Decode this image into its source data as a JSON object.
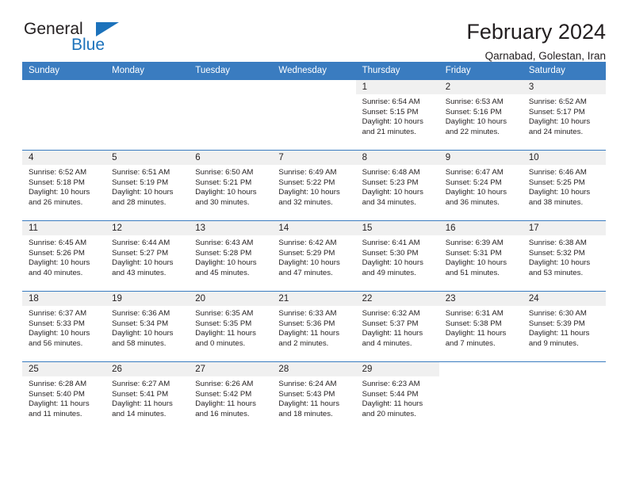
{
  "brand": {
    "name_part1": "General",
    "name_part2": "Blue",
    "triangle_icon": "triangle-icon",
    "accent_color": "#1c72bb"
  },
  "header": {
    "title": "February 2024",
    "subtitle": "Qarnabad, Golestan, Iran"
  },
  "theme": {
    "header_blue": "#3a7cc0",
    "daynum_band": "#f0f0f0",
    "text": "#231f20"
  },
  "weekday_headers": [
    "Sunday",
    "Monday",
    "Tuesday",
    "Wednesday",
    "Thursday",
    "Friday",
    "Saturday"
  ],
  "weeks": [
    [
      {
        "day": "",
        "sunrise": "",
        "sunset": "",
        "daylight_line1": "",
        "daylight_line2": ""
      },
      {
        "day": "",
        "sunrise": "",
        "sunset": "",
        "daylight_line1": "",
        "daylight_line2": ""
      },
      {
        "day": "",
        "sunrise": "",
        "sunset": "",
        "daylight_line1": "",
        "daylight_line2": ""
      },
      {
        "day": "",
        "sunrise": "",
        "sunset": "",
        "daylight_line1": "",
        "daylight_line2": ""
      },
      {
        "day": "1",
        "sunrise": "Sunrise: 6:54 AM",
        "sunset": "Sunset: 5:15 PM",
        "daylight_line1": "Daylight: 10 hours",
        "daylight_line2": "and 21 minutes."
      },
      {
        "day": "2",
        "sunrise": "Sunrise: 6:53 AM",
        "sunset": "Sunset: 5:16 PM",
        "daylight_line1": "Daylight: 10 hours",
        "daylight_line2": "and 22 minutes."
      },
      {
        "day": "3",
        "sunrise": "Sunrise: 6:52 AM",
        "sunset": "Sunset: 5:17 PM",
        "daylight_line1": "Daylight: 10 hours",
        "daylight_line2": "and 24 minutes."
      }
    ],
    [
      {
        "day": "4",
        "sunrise": "Sunrise: 6:52 AM",
        "sunset": "Sunset: 5:18 PM",
        "daylight_line1": "Daylight: 10 hours",
        "daylight_line2": "and 26 minutes."
      },
      {
        "day": "5",
        "sunrise": "Sunrise: 6:51 AM",
        "sunset": "Sunset: 5:19 PM",
        "daylight_line1": "Daylight: 10 hours",
        "daylight_line2": "and 28 minutes."
      },
      {
        "day": "6",
        "sunrise": "Sunrise: 6:50 AM",
        "sunset": "Sunset: 5:21 PM",
        "daylight_line1": "Daylight: 10 hours",
        "daylight_line2": "and 30 minutes."
      },
      {
        "day": "7",
        "sunrise": "Sunrise: 6:49 AM",
        "sunset": "Sunset: 5:22 PM",
        "daylight_line1": "Daylight: 10 hours",
        "daylight_line2": "and 32 minutes."
      },
      {
        "day": "8",
        "sunrise": "Sunrise: 6:48 AM",
        "sunset": "Sunset: 5:23 PM",
        "daylight_line1": "Daylight: 10 hours",
        "daylight_line2": "and 34 minutes."
      },
      {
        "day": "9",
        "sunrise": "Sunrise: 6:47 AM",
        "sunset": "Sunset: 5:24 PM",
        "daylight_line1": "Daylight: 10 hours",
        "daylight_line2": "and 36 minutes."
      },
      {
        "day": "10",
        "sunrise": "Sunrise: 6:46 AM",
        "sunset": "Sunset: 5:25 PM",
        "daylight_line1": "Daylight: 10 hours",
        "daylight_line2": "and 38 minutes."
      }
    ],
    [
      {
        "day": "11",
        "sunrise": "Sunrise: 6:45 AM",
        "sunset": "Sunset: 5:26 PM",
        "daylight_line1": "Daylight: 10 hours",
        "daylight_line2": "and 40 minutes."
      },
      {
        "day": "12",
        "sunrise": "Sunrise: 6:44 AM",
        "sunset": "Sunset: 5:27 PM",
        "daylight_line1": "Daylight: 10 hours",
        "daylight_line2": "and 43 minutes."
      },
      {
        "day": "13",
        "sunrise": "Sunrise: 6:43 AM",
        "sunset": "Sunset: 5:28 PM",
        "daylight_line1": "Daylight: 10 hours",
        "daylight_line2": "and 45 minutes."
      },
      {
        "day": "14",
        "sunrise": "Sunrise: 6:42 AM",
        "sunset": "Sunset: 5:29 PM",
        "daylight_line1": "Daylight: 10 hours",
        "daylight_line2": "and 47 minutes."
      },
      {
        "day": "15",
        "sunrise": "Sunrise: 6:41 AM",
        "sunset": "Sunset: 5:30 PM",
        "daylight_line1": "Daylight: 10 hours",
        "daylight_line2": "and 49 minutes."
      },
      {
        "day": "16",
        "sunrise": "Sunrise: 6:39 AM",
        "sunset": "Sunset: 5:31 PM",
        "daylight_line1": "Daylight: 10 hours",
        "daylight_line2": "and 51 minutes."
      },
      {
        "day": "17",
        "sunrise": "Sunrise: 6:38 AM",
        "sunset": "Sunset: 5:32 PM",
        "daylight_line1": "Daylight: 10 hours",
        "daylight_line2": "and 53 minutes."
      }
    ],
    [
      {
        "day": "18",
        "sunrise": "Sunrise: 6:37 AM",
        "sunset": "Sunset: 5:33 PM",
        "daylight_line1": "Daylight: 10 hours",
        "daylight_line2": "and 56 minutes."
      },
      {
        "day": "19",
        "sunrise": "Sunrise: 6:36 AM",
        "sunset": "Sunset: 5:34 PM",
        "daylight_line1": "Daylight: 10 hours",
        "daylight_line2": "and 58 minutes."
      },
      {
        "day": "20",
        "sunrise": "Sunrise: 6:35 AM",
        "sunset": "Sunset: 5:35 PM",
        "daylight_line1": "Daylight: 11 hours",
        "daylight_line2": "and 0 minutes."
      },
      {
        "day": "21",
        "sunrise": "Sunrise: 6:33 AM",
        "sunset": "Sunset: 5:36 PM",
        "daylight_line1": "Daylight: 11 hours",
        "daylight_line2": "and 2 minutes."
      },
      {
        "day": "22",
        "sunrise": "Sunrise: 6:32 AM",
        "sunset": "Sunset: 5:37 PM",
        "daylight_line1": "Daylight: 11 hours",
        "daylight_line2": "and 4 minutes."
      },
      {
        "day": "23",
        "sunrise": "Sunrise: 6:31 AM",
        "sunset": "Sunset: 5:38 PM",
        "daylight_line1": "Daylight: 11 hours",
        "daylight_line2": "and 7 minutes."
      },
      {
        "day": "24",
        "sunrise": "Sunrise: 6:30 AM",
        "sunset": "Sunset: 5:39 PM",
        "daylight_line1": "Daylight: 11 hours",
        "daylight_line2": "and 9 minutes."
      }
    ],
    [
      {
        "day": "25",
        "sunrise": "Sunrise: 6:28 AM",
        "sunset": "Sunset: 5:40 PM",
        "daylight_line1": "Daylight: 11 hours",
        "daylight_line2": "and 11 minutes."
      },
      {
        "day": "26",
        "sunrise": "Sunrise: 6:27 AM",
        "sunset": "Sunset: 5:41 PM",
        "daylight_line1": "Daylight: 11 hours",
        "daylight_line2": "and 14 minutes."
      },
      {
        "day": "27",
        "sunrise": "Sunrise: 6:26 AM",
        "sunset": "Sunset: 5:42 PM",
        "daylight_line1": "Daylight: 11 hours",
        "daylight_line2": "and 16 minutes."
      },
      {
        "day": "28",
        "sunrise": "Sunrise: 6:24 AM",
        "sunset": "Sunset: 5:43 PM",
        "daylight_line1": "Daylight: 11 hours",
        "daylight_line2": "and 18 minutes."
      },
      {
        "day": "29",
        "sunrise": "Sunrise: 6:23 AM",
        "sunset": "Sunset: 5:44 PM",
        "daylight_line1": "Daylight: 11 hours",
        "daylight_line2": "and 20 minutes."
      },
      {
        "day": "",
        "sunrise": "",
        "sunset": "",
        "daylight_line1": "",
        "daylight_line2": ""
      },
      {
        "day": "",
        "sunrise": "",
        "sunset": "",
        "daylight_line1": "",
        "daylight_line2": ""
      }
    ]
  ]
}
